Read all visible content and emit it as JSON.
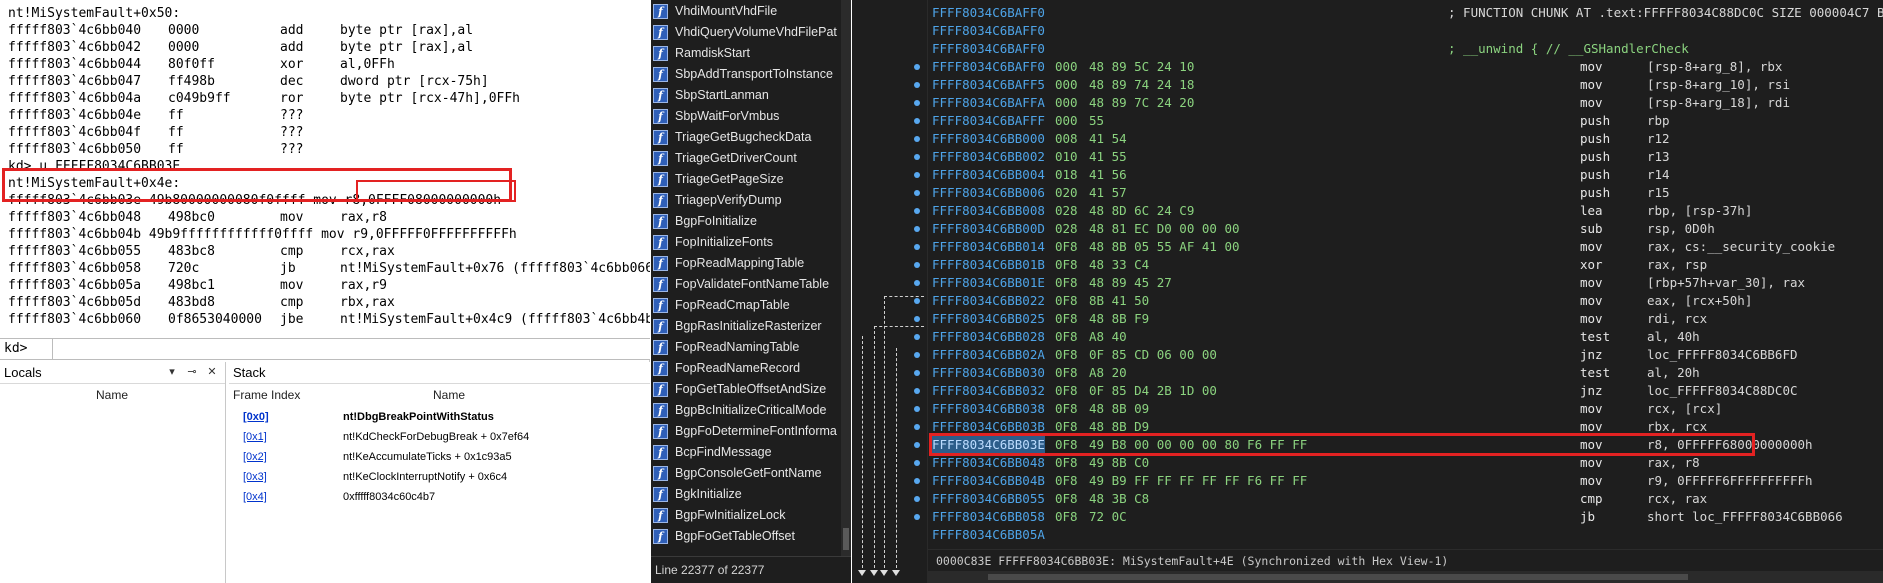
{
  "windbg": {
    "disasm_lines": [
      {
        "text": "nt!MiSystemFault+0x50:",
        "kind": "label"
      },
      {
        "addr": "fffff803`4c6bb040",
        "bytes": "0000",
        "mn": "add",
        "op": "byte ptr [rax],al"
      },
      {
        "addr": "fffff803`4c6bb042",
        "bytes": "0000",
        "mn": "add",
        "op": "byte ptr [rax],al"
      },
      {
        "addr": "fffff803`4c6bb044",
        "bytes": "80f0ff",
        "mn": "xor",
        "op": "al,0FFh"
      },
      {
        "addr": "fffff803`4c6bb047",
        "bytes": "ff498b",
        "mn": "dec",
        "op": "dword ptr [rcx-75h]"
      },
      {
        "addr": "fffff803`4c6bb04a",
        "bytes": "c049b9ff",
        "mn": "ror",
        "op": "byte ptr [rcx-47h],0FFh"
      },
      {
        "addr": "fffff803`4c6bb04e",
        "bytes": "ff",
        "mn": "???",
        "op": ""
      },
      {
        "addr": "fffff803`4c6bb04f",
        "bytes": "ff",
        "mn": "???",
        "op": ""
      },
      {
        "addr": "fffff803`4c6bb050",
        "bytes": "ff",
        "mn": "???",
        "op": ""
      },
      {
        "text": "kd> u FFFFF8034C6BB03E",
        "kind": "label"
      },
      {
        "text": "nt!MiSystemFault+0x4e:",
        "kind": "label"
      },
      {
        "text": "fffff803`4c6bb03e 49b80000000080f0ffff mov r8,0FFFF08000000000h",
        "kind": "label"
      },
      {
        "addr": "fffff803`4c6bb048",
        "bytes": "498bc0",
        "mn": "mov",
        "op": "rax,r8"
      },
      {
        "text": "fffff803`4c6bb04b 49b9ffffffffffff0ffff mov r9,0FFFFF0FFFFFFFFFFh",
        "kind": "label"
      },
      {
        "addr": "fffff803`4c6bb055",
        "bytes": "483bc8",
        "mn": "cmp",
        "op": "rcx,rax"
      },
      {
        "addr": "fffff803`4c6bb058",
        "bytes": "720c",
        "mn": "jb",
        "op": "nt!MiSystemFault+0x76 (fffff803`4c6bb066)"
      },
      {
        "addr": "fffff803`4c6bb05a",
        "bytes": "498bc1",
        "mn": "mov",
        "op": "rax,r9"
      },
      {
        "addr": "fffff803`4c6bb05d",
        "bytes": "483bd8",
        "mn": "cmp",
        "op": "rbx,rax"
      },
      {
        "addr": "fffff803`4c6bb060",
        "bytes": "0f8653040000",
        "mn": "jbe",
        "op": "nt!MiSystemFault+0x4c9 (fffff803`4c6bb4b9"
      }
    ],
    "command": {
      "prompt": "kd>",
      "value": ""
    },
    "locals": {
      "title": "Locals",
      "name_header": "Name"
    },
    "stack": {
      "title": "Stack",
      "headers": {
        "index": "Frame Index",
        "name": "Name"
      },
      "rows": [
        {
          "index": "[0x0]",
          "name": "nt!DbgBreakPointWithStatus"
        },
        {
          "index": "[0x1]",
          "name": "nt!KdCheckForDebugBreak + 0x7ef64"
        },
        {
          "index": "[0x2]",
          "name": "nt!KeAccumulateTicks + 0x1c93a5"
        },
        {
          "index": "[0x3]",
          "name": "nt!KeClockInterruptNotify + 0x6c4"
        },
        {
          "index": "[0x4]",
          "name": "0xfffff8034c60c4b7"
        }
      ]
    }
  },
  "functions": {
    "items": [
      "VhdiMountVhdFile",
      "VhdiQueryVolumeVhdFilePat",
      "RamdiskStart",
      "SbpAddTransportToInstance",
      "SbpStartLanman",
      "SbpWaitForVmbus",
      "TriageGetBugcheckData",
      "TriageGetDriverCount",
      "TriageGetPageSize",
      "TriagepVerifyDump",
      "BgpFoInitialize",
      "FopInitializeFonts",
      "FopReadMappingTable",
      "FopValidateFontNameTable",
      "FopReadCmapTable",
      "BgpRasInitializeRasterizer",
      "FopReadNamingTable",
      "FopReadNameRecord",
      "FopGetTableOffsetAndSize",
      "BgpBcInitializeCriticalMode",
      "BgpFoDetermineFontInforma",
      "BcpFindMessage",
      "BgpConsoleGetFontName",
      "BgkInitialize",
      "BgpFwInitializeLock",
      "BgpFoGetTableOffset"
    ],
    "status": "Line 22377 of 22377"
  },
  "ida": {
    "lines": [
      {
        "addr": "FFFF8034C6BAFF0",
        "cm": "; FUNCTION CHUNK AT .text:FFFFF8034C88DC0C SIZE 000004C7 BYTES"
      },
      {
        "addr": "FFFF8034C6BAFF0"
      },
      {
        "addr": "FFFF8034C6BAFF0",
        "cm": "; __unwind { // __GSHandlerCheck",
        "cm_color": "green"
      },
      {
        "addr": "FFFF8034C6BAFF0",
        "sp": "000",
        "bytes": "48 89 5C 24 10",
        "mn": "mov",
        "op": "[rsp-8+arg_8], rbx"
      },
      {
        "addr": "FFFF8034C6BAFF5",
        "sp": "000",
        "bytes": "48 89 74 24 18",
        "mn": "mov",
        "op": "[rsp-8+arg_10], rsi"
      },
      {
        "addr": "FFFF8034C6BAFFA",
        "sp": "000",
        "bytes": "48 89 7C 24 20",
        "mn": "mov",
        "op": "[rsp-8+arg_18], rdi"
      },
      {
        "addr": "FFFF8034C6BAFFF",
        "sp": "000",
        "bytes": "55",
        "mn": "push",
        "op": "rbp"
      },
      {
        "addr": "FFFF8034C6BB000",
        "sp": "008",
        "bytes": "41 54",
        "mn": "push",
        "op": "r12"
      },
      {
        "addr": "FFFF8034C6BB002",
        "sp": "010",
        "bytes": "41 55",
        "mn": "push",
        "op": "r13"
      },
      {
        "addr": "FFFF8034C6BB004",
        "sp": "018",
        "bytes": "41 56",
        "mn": "push",
        "op": "r14"
      },
      {
        "addr": "FFFF8034C6BB006",
        "sp": "020",
        "bytes": "41 57",
        "mn": "push",
        "op": "r15"
      },
      {
        "addr": "FFFF8034C6BB008",
        "sp": "028",
        "bytes": "48 8D 6C 24 C9",
        "mn": "lea",
        "op": "rbp, [rsp-37h]"
      },
      {
        "addr": "FFFF8034C6BB00D",
        "sp": "028",
        "bytes": "48 81 EC D0 00 00 00",
        "mn": "sub",
        "op": "rsp, 0D0h"
      },
      {
        "addr": "FFFF8034C6BB014",
        "sp": "0F8",
        "bytes": "48 8B 05 55 AF 41 00",
        "mn": "mov",
        "op": "rax, cs:__security_cookie"
      },
      {
        "addr": "FFFF8034C6BB01B",
        "sp": "0F8",
        "bytes": "48 33 C4",
        "mn": "xor",
        "op": "rax, rsp"
      },
      {
        "addr": "FFFF8034C6BB01E",
        "sp": "0F8",
        "bytes": "48 89 45 27",
        "mn": "mov",
        "op": "[rbp+57h+var_30], rax"
      },
      {
        "addr": "FFFF8034C6BB022",
        "sp": "0F8",
        "bytes": "8B 41 50",
        "mn": "mov",
        "op": "eax, [rcx+50h]"
      },
      {
        "addr": "FFFF8034C6BB025",
        "sp": "0F8",
        "bytes": "48 8B F9",
        "mn": "mov",
        "op": "rdi, rcx"
      },
      {
        "addr": "FFFF8034C6BB028",
        "sp": "0F8",
        "bytes": "A8 40",
        "mn": "test",
        "op": "al, 40h"
      },
      {
        "addr": "FFFF8034C6BB02A",
        "sp": "0F8",
        "bytes": "0F 85 CD 06 00 00",
        "mn": "jnz",
        "op": "loc_FFFFF8034C6BB6FD"
      },
      {
        "addr": "FFFF8034C6BB030",
        "sp": "0F8",
        "bytes": "A8 20",
        "mn": "test",
        "op": "al, 20h"
      },
      {
        "addr": "FFFF8034C6BB032",
        "sp": "0F8",
        "bytes": "0F 85 D4 2B 1D 00",
        "mn": "jnz",
        "op": "loc_FFFFF8034C88DC0C"
      },
      {
        "addr": "FFFF8034C6BB038",
        "sp": "0F8",
        "bytes": "48 8B 09",
        "mn": "mov",
        "op": "rcx, [rcx]"
      },
      {
        "addr": "FFFF8034C6BB03B",
        "sp": "0F8",
        "bytes": "48 8B D9",
        "mn": "mov",
        "op": "rbx, rcx"
      },
      {
        "addr": "FFFF8034C6BB03E",
        "sp": "0F8",
        "bytes": "49 B8 00 00 00 00 80 F6 FF FF",
        "mn": "mov",
        "op": "r8, 0FFFFF68000000000h",
        "selected": true
      },
      {
        "addr": "FFFF8034C6BB048",
        "sp": "0F8",
        "bytes": "49 8B C0",
        "mn": "mov",
        "op": "rax, r8"
      },
      {
        "addr": "FFFF8034C6BB04B",
        "sp": "0F8",
        "bytes": "49 B9 FF FF FF FF FF F6 FF FF",
        "mn": "mov",
        "op": "r9, 0FFFFF6FFFFFFFFFFh"
      },
      {
        "addr": "FFFF8034C6BB055",
        "sp": "0F8",
        "bytes": "48 3B C8",
        "mn": "cmp",
        "op": "rcx, rax"
      },
      {
        "addr": "FFFF8034C6BB058",
        "sp": "0F8",
        "bytes": "72 0C",
        "mn": "jb",
        "op": "short loc_FFFFF8034C6BB066"
      },
      {
        "addr": "FFFF8034C6BB05A"
      }
    ],
    "status": "0000C83E FFFFF8034C6BB03E: MiSystemFault+4E (Synchronized with Hex View-1)"
  },
  "colors": {
    "highlight": "#e32222",
    "ida_address": "#4ea4e8",
    "ida_bytes": "#8bd37f",
    "stack_link": "#0033cc"
  },
  "icons": {
    "function_item": "function-icon",
    "locals_dropdown": "chevron-down-icon",
    "locals_pin": "pin-icon",
    "locals_close": "close-icon"
  }
}
